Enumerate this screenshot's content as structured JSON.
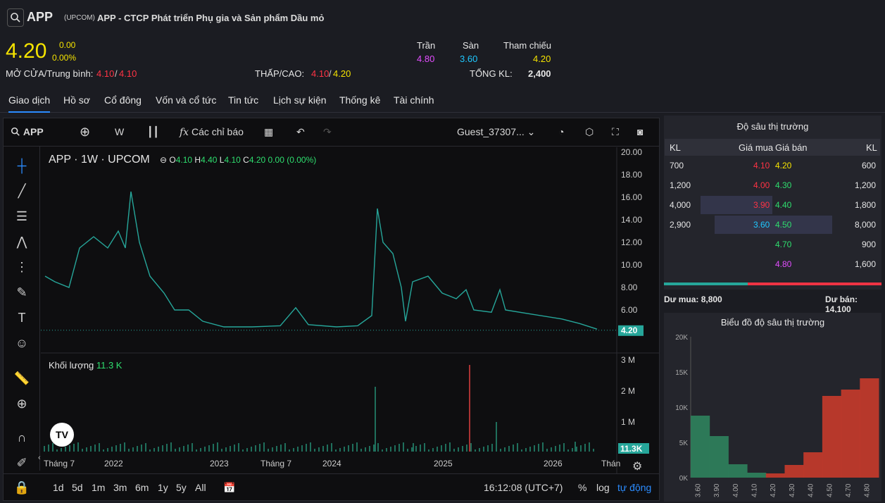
{
  "header": {
    "symbol": "APP",
    "exchange": "(UPCOM)",
    "company": "APP - CTCP Phát triển Phụ gia và Sản phẩm Dầu mỏ",
    "price": "4.20",
    "change": "0.00",
    "change_pct": "0.00%",
    "open_avg_label": "MỞ CỬA/Trung bình:",
    "open": "4.10",
    "avg": "4.10",
    "low_high_label": "THẤP/CAO:",
    "low": "4.10",
    "high": "4.20",
    "ceiling_label": "Trần",
    "ceiling": "4.80",
    "floor_label": "Sàn",
    "floor": "3.60",
    "ref_label": "Tham chiếu",
    "ref": "4.20",
    "vol_label": "TỔNG KL:",
    "vol": "2,400"
  },
  "tabs": [
    "Giao dịch",
    "Hồ sơ",
    "Cổ đông",
    "Vốn và cổ tức",
    "Tin tức",
    "Lịch sự kiện",
    "Thống kê",
    "Tài chính"
  ],
  "toolbar": {
    "symbol": "APP",
    "interval": "W",
    "indicators": "Các chỉ báo",
    "user": "Guest_37307..."
  },
  "chart": {
    "legend": "APP · 1W · UPCOM",
    "o": "4.10",
    "h": "4.40",
    "l": "4.10",
    "c": "4.20",
    "chg": "0.00 (0.00%)",
    "last_price": "4.20",
    "vol_label": "Khối lượng",
    "vol_value": "11.3 K",
    "vol_tag": "11.3K",
    "y_ticks": [
      "20.00",
      "18.00",
      "16.00",
      "14.00",
      "12.00",
      "10.00",
      "8.00",
      "6.00"
    ],
    "vol_ticks": [
      "3 M",
      "2 M",
      "1 M"
    ],
    "x_ticks": [
      "Tháng 7",
      "2022",
      "2023",
      "Tháng 7",
      "2024",
      "2025",
      "2026",
      "Thán"
    ],
    "ranges": [
      "1d",
      "5d",
      "1m",
      "3m",
      "6m",
      "1y",
      "5y",
      "All"
    ],
    "time": "16:12:08 (UTC+7)",
    "pct": "%",
    "log": "log",
    "auto": "tự động"
  },
  "depth": {
    "title": "Độ sâu thị trường",
    "h_kl": "KL",
    "h_buy": "Giá mua",
    "h_sell": "Giá bán",
    "h_kl2": "KL",
    "rows": [
      [
        "700",
        "4.10",
        "4.20",
        "600"
      ],
      [
        "1,200",
        "4.00",
        "4.30",
        "1,200"
      ],
      [
        "4,000",
        "3.90",
        "4.40",
        "1,800"
      ],
      [
        "2,900",
        "3.60",
        "4.50",
        "8,000"
      ],
      [
        "",
        "",
        "4.70",
        "900"
      ],
      [
        "",
        "",
        "4.80",
        "1,600"
      ]
    ],
    "buy_total": "Dư mua: 8,800",
    "sell_total": "Dư bán: 14,100"
  },
  "depth_chart": {
    "title": "Biểu đồ độ sâu thị trường",
    "y_ticks": [
      "20K",
      "15K",
      "10K",
      "5K",
      "0K"
    ],
    "x_ticks": [
      "3.60",
      "3.90",
      "4.00",
      "4.10",
      "4.20",
      "4.30",
      "4.40",
      "4.50",
      "4.70",
      "4.80"
    ],
    "chart_data": {
      "type": "area",
      "x": [
        "3.60",
        "3.90",
        "4.00",
        "4.10",
        "4.20",
        "4.30",
        "4.40",
        "4.50",
        "4.70",
        "4.80"
      ],
      "series": [
        {
          "values": [
            8800,
            5900,
            1900,
            700,
            0,
            0,
            0,
            0,
            0,
            0
          ]
        },
        {
          "values": [
            0,
            0,
            0,
            0,
            600,
            1800,
            3600,
            11600,
            12500,
            14100
          ]
        }
      ],
      "ylim": [
        0,
        20000
      ]
    }
  },
  "colors": {
    "up": "#26a69a",
    "down": "#ef5350",
    "accent": "#2b8cff"
  }
}
